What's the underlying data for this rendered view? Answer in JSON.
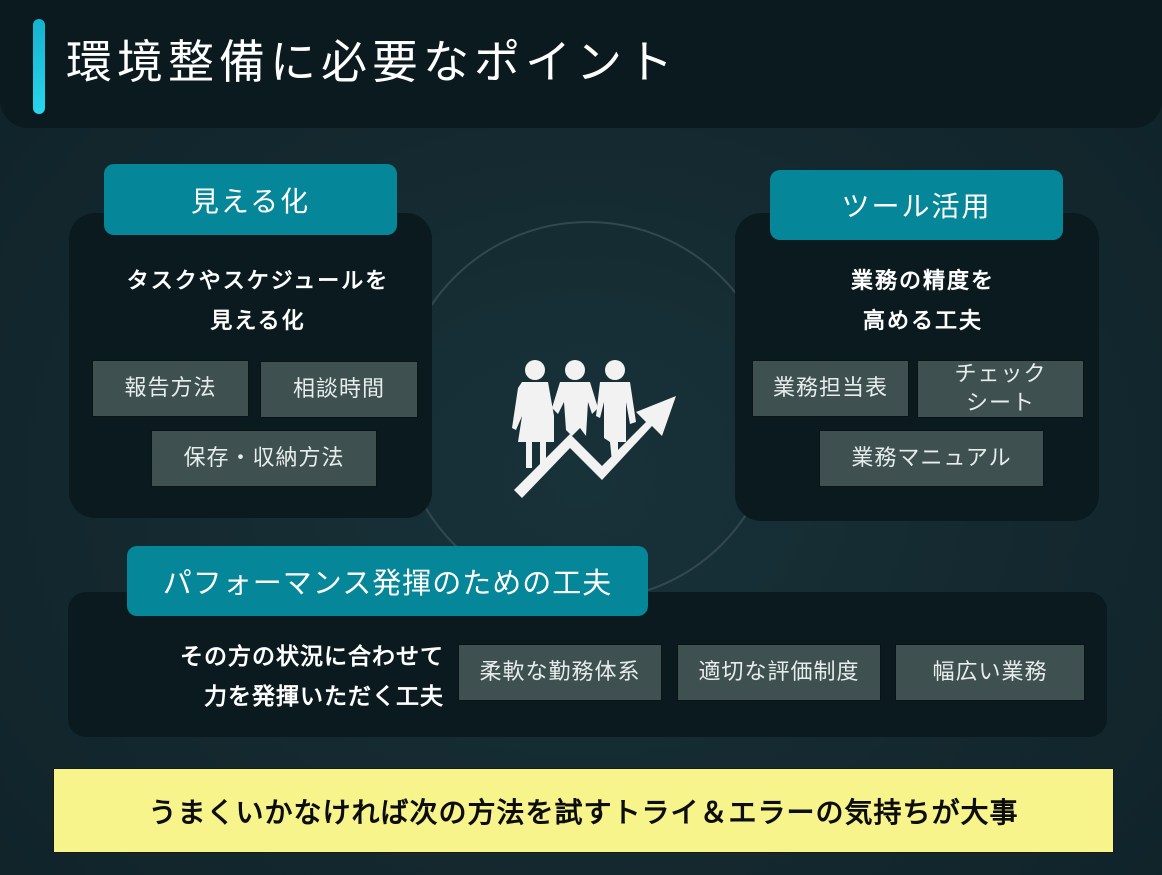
{
  "title": "環境整備に必要なポイント",
  "colors": {
    "background": "#13282e",
    "header": "#0a1a1f",
    "accent_bar": "#1fc3df",
    "tab": "#068799",
    "card": "#0a1a1f",
    "chip": "#3f5050",
    "footer": "#f6f48a"
  },
  "visualize": {
    "tab_label": "見える化",
    "lead_line1": "タスクやスケジュールを",
    "lead_line2": "見える化",
    "chips": [
      "報告方法",
      "相談時間",
      "保存・収納方法"
    ]
  },
  "tools": {
    "tab_label": "ツール活用",
    "lead_line1": "業務の精度を",
    "lead_line2": "高める工夫",
    "chips": [
      "業務担当表",
      "チェック\nシート",
      "業務マニュアル"
    ],
    "chip2_line1": "チェック",
    "chip2_line2": "シート"
  },
  "performance": {
    "tab_label": "パフォーマンス発揮のための工夫",
    "lead_line1": "その方の状況に合わせて",
    "lead_line2": "力を発揮いただく工夫",
    "chips": [
      "柔軟な勤務体系",
      "適切な評価制度",
      "幅広い業務"
    ]
  },
  "center_icon": "team-growth-icon",
  "footer": "うまくいかなければ次の方法を試すトライ＆エラーの気持ちが大事"
}
